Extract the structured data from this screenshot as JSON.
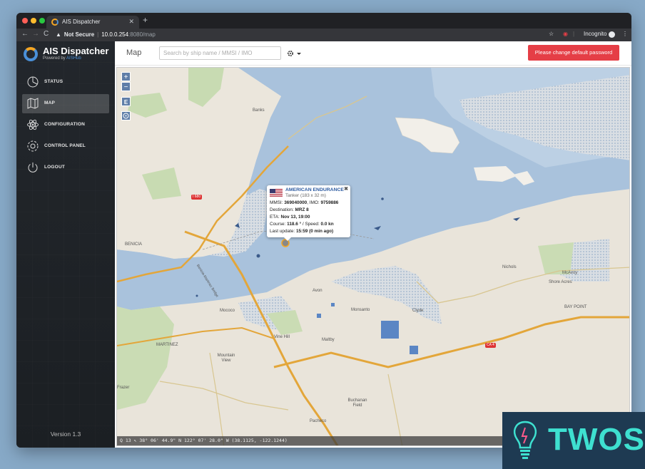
{
  "browser": {
    "tab_title": "AIS Dispatcher",
    "url_warning": "Not Secure",
    "url_host": "10.0.0.254",
    "url_path": ":8080/map",
    "incognito_label": "Incognito"
  },
  "sidebar": {
    "brand_name": "AIS Dispatcher",
    "powered_prefix": "Powered by ",
    "powered_link": "AISHub",
    "items": [
      {
        "label": "STATUS",
        "icon": "dashboard-icon",
        "active": false
      },
      {
        "label": "MAP",
        "icon": "map-icon",
        "active": true
      },
      {
        "label": "CONFIGURATION",
        "icon": "atom-icon",
        "active": false
      },
      {
        "label": "CONTROL PANEL",
        "icon": "gear-icon",
        "active": false
      },
      {
        "label": "LOGOUT",
        "icon": "power-icon",
        "active": false
      }
    ],
    "version": "Version 1.3"
  },
  "header": {
    "title": "Map",
    "search_placeholder": "Search by ship name / MMSI / IMO",
    "alert_text": "Please change default password"
  },
  "map": {
    "controls": {
      "zoom_in": "+",
      "zoom_out": "−",
      "layer_e": "E"
    },
    "labels": {
      "benicia": "BENICIA",
      "martinez": "MARTINEZ",
      "bay_point": "BAY POINT",
      "nichols": "Nichols",
      "mcavoy": "McAvoy",
      "shore_acres": "Shore Acres",
      "avon": "Avon",
      "monsanto": "Monsanto",
      "clyde": "Clyde",
      "mococo": "Mococo",
      "vine_hill": "Vine Hill",
      "mountain_view": "Mountain View",
      "maltby": "Maltby",
      "pacheco": "Pacheco",
      "buchanan_field": "Buchanan Field",
      "frazer": "Frazer",
      "banks": "Banks",
      "bridge": "Benicia-Martinez Bridge",
      "i680": "I 680",
      "ca4": "CA 4"
    },
    "popup": {
      "ship_name": "AMERICAN ENDURANCE",
      "ship_type": "Tanker (183 x 32 m)",
      "mmsi_label": "MMSI: ",
      "mmsi": "369040000",
      "imo_label": ", IMO: ",
      "imo": "9759886",
      "destination_label": "Destination: ",
      "destination": "MRZ 8",
      "eta_label": "ETA: ",
      "eta": "Nov 13, 19:00",
      "course_label": "Course: ",
      "course": "118.6 °",
      "speed_label": " / Speed: ",
      "speed": "0.0 kn",
      "last_update_label": "Last update: ",
      "last_update": "15:59 (0 min ago)"
    },
    "status_bar": "Q 13 ↖ 38° 06' 44.9\" N 122° 07' 28.0\" W (38.1125, -122.1244)"
  },
  "watermark": {
    "text": "TWOS"
  },
  "colors": {
    "accent": "#4a90d9",
    "alert": "#e53e46",
    "water": "#a9c2dc",
    "land": "#e9e4da"
  }
}
